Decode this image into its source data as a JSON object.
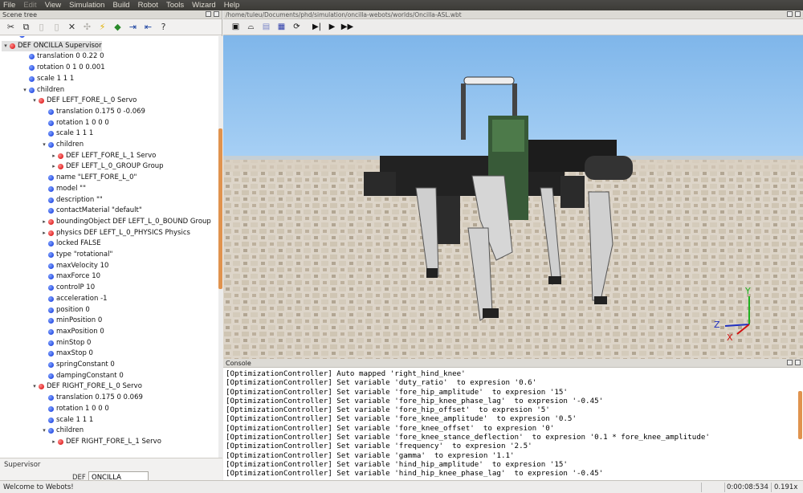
{
  "menu": [
    "File",
    "Edit",
    "View",
    "Simulation",
    "Build",
    "Robot",
    "Tools",
    "Wizard",
    "Help"
  ],
  "scene_tree": {
    "title": "Scene tree",
    "toolbar_icons": [
      "cut-icon",
      "copy-icon",
      "paste-icon",
      "paste-icon",
      "delete-icon",
      "move-icon",
      "lightning-icon",
      "add-node-icon",
      "import-icon",
      "export-icon",
      "help-icon"
    ],
    "help_glyph": "?",
    "nodes": [
      {
        "label": "castShadows TRUE",
        "arrow": "",
        "dot": "b"
      },
      {
        "label": "DEF ONCILLA Supervisor",
        "arrow": "▾",
        "dot": "r"
      },
      {
        "label": "translation 0 0.22 0",
        "arrow": "",
        "dot": "b"
      },
      {
        "label": "rotation 0 1 0 0.001",
        "arrow": "",
        "dot": "b"
      },
      {
        "label": "scale 1 1 1",
        "arrow": "",
        "dot": "b"
      },
      {
        "label": "children",
        "arrow": "▾",
        "dot": "b"
      },
      {
        "label": "DEF LEFT_FORE_L_0 Servo",
        "arrow": "▾",
        "dot": "r"
      },
      {
        "label": "translation 0.175 0 -0.069",
        "arrow": "",
        "dot": "b"
      },
      {
        "label": "rotation 1 0 0 0",
        "arrow": "",
        "dot": "b"
      },
      {
        "label": "scale 1 1 1",
        "arrow": "",
        "dot": "b"
      },
      {
        "label": "children",
        "arrow": "▾",
        "dot": "b"
      },
      {
        "label": "DEF LEFT_FORE_L_1 Servo",
        "arrow": "▸",
        "dot": "r"
      },
      {
        "label": "DEF LEFT_L_0_GROUP Group",
        "arrow": "▸",
        "dot": "r"
      },
      {
        "label": "name \"LEFT_FORE_L_0\"",
        "arrow": "",
        "dot": "b"
      },
      {
        "label": "model \"\"",
        "arrow": "",
        "dot": "b"
      },
      {
        "label": "description \"\"",
        "arrow": "",
        "dot": "b"
      },
      {
        "label": "contactMaterial \"default\"",
        "arrow": "",
        "dot": "b"
      },
      {
        "label": "boundingObject DEF LEFT_L_0_BOUND Group",
        "arrow": "▸",
        "dot": "r"
      },
      {
        "label": "physics DEF LEFT_L_0_PHYSICS Physics",
        "arrow": "▸",
        "dot": "r"
      },
      {
        "label": "locked FALSE",
        "arrow": "",
        "dot": "b"
      },
      {
        "label": "type \"rotational\"",
        "arrow": "",
        "dot": "b"
      },
      {
        "label": "maxVelocity 10",
        "arrow": "",
        "dot": "b"
      },
      {
        "label": "maxForce 10",
        "arrow": "",
        "dot": "b"
      },
      {
        "label": "controlP 10",
        "arrow": "",
        "dot": "b"
      },
      {
        "label": "acceleration -1",
        "arrow": "",
        "dot": "b"
      },
      {
        "label": "position 0",
        "arrow": "",
        "dot": "b"
      },
      {
        "label": "minPosition 0",
        "arrow": "",
        "dot": "b"
      },
      {
        "label": "maxPosition 0",
        "arrow": "",
        "dot": "b"
      },
      {
        "label": "minStop 0",
        "arrow": "",
        "dot": "b"
      },
      {
        "label": "maxStop 0",
        "arrow": "",
        "dot": "b"
      },
      {
        "label": "springConstant 0",
        "arrow": "",
        "dot": "b"
      },
      {
        "label": "dampingConstant 0",
        "arrow": "",
        "dot": "b"
      },
      {
        "label": "DEF RIGHT_FORE_L_0 Servo",
        "arrow": "▾",
        "dot": "r"
      },
      {
        "label": "translation 0.175 0 0.069",
        "arrow": "",
        "dot": "b"
      },
      {
        "label": "rotation 1 0 0 0",
        "arrow": "",
        "dot": "b"
      },
      {
        "label": "scale 1 1 1",
        "arrow": "",
        "dot": "b"
      },
      {
        "label": "children",
        "arrow": "▾",
        "dot": "b"
      },
      {
        "label": "DEF RIGHT_FORE_L_1 Servo",
        "arrow": "▸",
        "dot": "r"
      }
    ]
  },
  "supervisor": {
    "legend": "Supervisor",
    "def_label": "DEF",
    "def_value": "ONCILLA"
  },
  "world_path": "/home/tuleu/Documents/phd/simulation/oncilla-webots/worlds/Oncilla-ASL.wbt",
  "sim_toolbar": [
    "new-world-icon",
    "open-world-icon",
    "save-world-icon",
    "save-as-icon",
    "revert-icon",
    "step-icon",
    "run-icon",
    "fast-icon"
  ],
  "console": {
    "title": "Console",
    "lines": [
      "[OptimizationController] Auto mapped 'right_hind_knee'",
      "[OptimizationController] Set variable 'duty_ratio'  to expresion '0.6'",
      "[OptimizationController] Set variable 'fore_hip_amplitude'  to expresion '15'",
      "[OptimizationController] Set variable 'fore_hip_knee_phase_lag'  to expresion '-0.45'",
      "[OptimizationController] Set variable 'fore_hip_offset'  to expresion '5'",
      "[OptimizationController] Set variable 'fore_knee_amplitude'  to expresion '0.5'",
      "[OptimizationController] Set variable 'fore_knee_offset'  to expresion '0'",
      "[OptimizationController] Set variable 'fore_knee_stance_deflection'  to expresion '0.1 * fore_knee_amplitude'",
      "[OptimizationController] Set variable 'frequency'  to expresion '2.5'",
      "[OptimizationController] Set variable 'gamma'  to expresion '1.1'",
      "[OptimizationController] Set variable 'hind_hip_amplitude'  to expresion '15'",
      "[OptimizationController] Set variable 'hind_hip_knee_phase_lag'  to expresion '-0.45'"
    ]
  },
  "axes": {
    "y": "Y",
    "z": "Z",
    "x": "X"
  },
  "status": {
    "message": "Welcome to Webots!",
    "time": "0:00:08:534",
    "speed": "0.191x"
  },
  "colors": {
    "sky": "#8fc0ee",
    "floor": "#d8cfc0",
    "accent": "#e0934e"
  }
}
